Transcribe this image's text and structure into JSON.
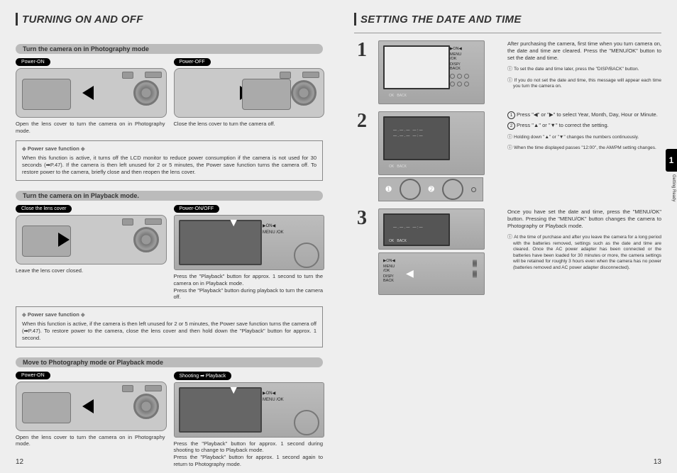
{
  "left": {
    "title": "TURNING ON AND OFF",
    "s1": {
      "header": "Turn the camera on in Photography mode",
      "pill_on": "Power-ON",
      "pill_off": "Power-OFF",
      "cap_on": "Open the lens cover to turn the camera on in Photography mode.",
      "cap_off": "Close the lens cover to turn the camera off."
    },
    "psf1": {
      "title": "Power save function",
      "body": "When this function is active, it turns off the LCD monitor to reduce power consumption if the camera is not used for 30 seconds (➡P.47). If the camera is then left unused for 2 or 5 minutes, the Power save function turns the camera off. To restore power to the camera, briefly close and then reopen the lens cover."
    },
    "s2": {
      "header": "Turn the camera on in Playback mode.",
      "pill_close": "Close the lens cover",
      "pill_onoff": "Power-ON/OFF",
      "cap_left": "Leave the lens cover closed.",
      "cap_right": "Press the \"Playback\" button for approx. 1 second to turn the camera on in Playback mode.\nPress the \"Playback\" button during playback to turn the camera off."
    },
    "psf2": {
      "title": "Power save function",
      "body": "When this function is active, if the camera is then left unused for 2 or 5 minutes, the Power save function turns the camera off (➡P.47). To restore power to the camera, close the lens cover and then hold down the \"Playback\" button for approx. 1 second."
    },
    "s3": {
      "header": "Move to Photography mode or Playback mode",
      "pill_on": "Power-ON",
      "pill_shoot": "Shooting ➡ Playback",
      "cap_left": "Open the lens cover to turn the camera on in Photography mode.",
      "cap_right": "Press the \"Playback\" button for approx. 1 second during shooting to change to Playback mode.\nPress the \"Playback\" button for approx. 1 second again to return to Photography mode."
    },
    "pagenum": "12"
  },
  "right": {
    "title": "SETTING THE DATE AND TIME",
    "step1": {
      "num": "1",
      "body": "After purchasing the camera, first time when you turn camera on, the date and time are cleared. Press the \"MENU/OK\" button to set the date and time.",
      "note_a": "To set the date and time later, press the \"DISP/BACK\" button.",
      "note_b": "If you do not set the date and time, this message will appear each time you turn the camera on."
    },
    "step2": {
      "num": "2",
      "line1_pre": "Press \"◀\" or \"▶\" to select Year, Month, Day, Hour or Minute.",
      "line2_pre": "Press \"▲\" or \"▼\" to correct the setting.",
      "note_a": "Holding down \"▲\" or \"▼\" changes the numbers continuously.",
      "note_b": "When the time displayed passes \"12:00\", the AM/PM setting changes."
    },
    "step3": {
      "num": "3",
      "body": "Once you have set the date and time, press the \"MENU/OK\" button. Pressing the \"MENU/OK\" button changes the camera to Photography or Playback mode.",
      "note": "At the time of purchase and after you leave the camera for a long period with the batteries removed, settings such as the date and time are cleared. Once the AC power adapter has been connected or the batteries have been loaded for 30 minutes or more, the camera settings will be retained for roughly 3 hours even when the camera has no power (batteries removed and AC power adapter disconnected)."
    },
    "lcd_labels": {
      "on": "▶ON◀",
      "menu": "MENU\n/OK",
      "disp": "DISP/\nBACK"
    },
    "tab": "1",
    "tab_label": "Getting Ready",
    "pagenum": "13"
  }
}
